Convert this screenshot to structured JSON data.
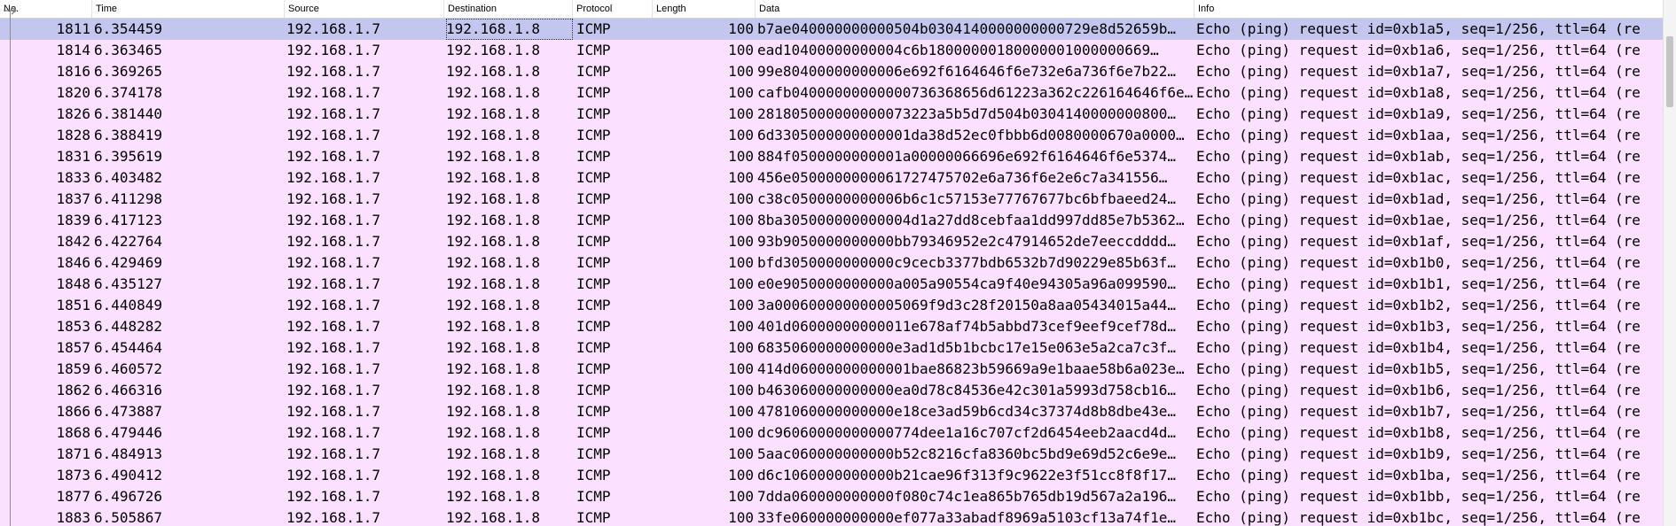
{
  "columns": [
    {
      "key": "no",
      "label": "No."
    },
    {
      "key": "time",
      "label": "Time"
    },
    {
      "key": "source",
      "label": "Source"
    },
    {
      "key": "destination",
      "label": "Destination"
    },
    {
      "key": "protocol",
      "label": "Protocol"
    },
    {
      "key": "length",
      "label": "Length"
    },
    {
      "key": "data",
      "label": "Data"
    },
    {
      "key": "info",
      "label": "Info"
    }
  ],
  "colors": {
    "row_bg": "#fce0ff",
    "selected_bg": "#c3c6ef"
  },
  "icons": {
    "selected_row_marker": "arrow-right-icon"
  },
  "packets": [
    {
      "no": "1811",
      "time": "6.354459",
      "source": "192.168.1.7",
      "destination": "192.168.1.8",
      "protocol": "ICMP",
      "length": "100",
      "data": "b7ae040000000000504b0304140000000000729e8d52659b…",
      "info": "Echo (ping) request  id=0xb1a5, seq=1/256, ttl=64 (re",
      "selected": true
    },
    {
      "no": "1814",
      "time": "6.363465",
      "source": "192.168.1.7",
      "destination": "192.168.1.8",
      "protocol": "ICMP",
      "length": "100",
      "data": "ead10400000000004c6b18000000180000001000000669…",
      "info": "Echo (ping) request  id=0xb1a6, seq=1/256, ttl=64 (re"
    },
    {
      "no": "1816",
      "time": "6.369265",
      "source": "192.168.1.7",
      "destination": "192.168.1.8",
      "protocol": "ICMP",
      "length": "100",
      "data": "99e80400000000006e692f6164646f6e732e6a736f6e7b22…",
      "info": "Echo (ping) request  id=0xb1a7, seq=1/256, ttl=64 (re"
    },
    {
      "no": "1820",
      "time": "6.374178",
      "source": "192.168.1.7",
      "destination": "192.168.1.8",
      "protocol": "ICMP",
      "length": "100",
      "data": "cafb04000000000000736368656d61223a362c226164646f6e…",
      "info": "Echo (ping) request  id=0xb1a8, seq=1/256, ttl=64 (re"
    },
    {
      "no": "1826",
      "time": "6.381440",
      "source": "192.168.1.7",
      "destination": "192.168.1.8",
      "protocol": "ICMP",
      "length": "100",
      "data": "281805000000000073223a5b5d7d504b0304140000000800…",
      "info": "Echo (ping) request  id=0xb1a9, seq=1/256, ttl=64 (re"
    },
    {
      "no": "1828",
      "time": "6.388419",
      "source": "192.168.1.7",
      "destination": "192.168.1.8",
      "protocol": "ICMP",
      "length": "100",
      "data": "6d3305000000000001da38d52ec0fbbb6d0080000670a0000…",
      "info": "Echo (ping) request  id=0xb1aa, seq=1/256, ttl=64 (re"
    },
    {
      "no": "1831",
      "time": "6.395619",
      "source": "192.168.1.7",
      "destination": "192.168.1.8",
      "protocol": "ICMP",
      "length": "100",
      "data": "884f0500000000001a00000066696e692f6164646f6e5374…",
      "info": "Echo (ping) request  id=0xb1ab, seq=1/256, ttl=64 (re"
    },
    {
      "no": "1833",
      "time": "6.403482",
      "source": "192.168.1.7",
      "destination": "192.168.1.8",
      "protocol": "ICMP",
      "length": "100",
      "data": "456e0500000000061727475702e6a736f6e2e6c7a341556…",
      "info": "Echo (ping) request  id=0xb1ac, seq=1/256, ttl=64 (re"
    },
    {
      "no": "1837",
      "time": "6.411298",
      "source": "192.168.1.7",
      "destination": "192.168.1.8",
      "protocol": "ICMP",
      "length": "100",
      "data": "c38c0500000000006b6c1c57153e77767677bc6bfbaeed24…",
      "info": "Echo (ping) request  id=0xb1ad, seq=1/256, ttl=64 (re"
    },
    {
      "no": "1839",
      "time": "6.417123",
      "source": "192.168.1.7",
      "destination": "192.168.1.8",
      "protocol": "ICMP",
      "length": "100",
      "data": "8ba305000000000004d1a27dd8cebfaa1dd997dd85e7b5362…",
      "info": "Echo (ping) request  id=0xb1ae, seq=1/256, ttl=64 (re"
    },
    {
      "no": "1842",
      "time": "6.422764",
      "source": "192.168.1.7",
      "destination": "192.168.1.8",
      "protocol": "ICMP",
      "length": "100",
      "data": "93b9050000000000bb79346952e2c47914652de7eeccdddd…",
      "info": "Echo (ping) request  id=0xb1af, seq=1/256, ttl=64 (re"
    },
    {
      "no": "1846",
      "time": "6.429469",
      "source": "192.168.1.7",
      "destination": "192.168.1.8",
      "protocol": "ICMP",
      "length": "100",
      "data": "bfd3050000000000c9cecb3377bdb6532b7d90229e85b63f…",
      "info": "Echo (ping) request  id=0xb1b0, seq=1/256, ttl=64 (re"
    },
    {
      "no": "1848",
      "time": "6.435127",
      "source": "192.168.1.7",
      "destination": "192.168.1.8",
      "protocol": "ICMP",
      "length": "100",
      "data": "e0e9050000000000a005a90554ca9f40e94305a96a099590…",
      "info": "Echo (ping) request  id=0xb1b1, seq=1/256, ttl=64 (re"
    },
    {
      "no": "1851",
      "time": "6.440849",
      "source": "192.168.1.7",
      "destination": "192.168.1.8",
      "protocol": "ICMP",
      "length": "100",
      "data": "3a000600000000005069f9d3c28f20150a8aa05434015a44…",
      "info": "Echo (ping) request  id=0xb1b2, seq=1/256, ttl=64 (re"
    },
    {
      "no": "1853",
      "time": "6.448282",
      "source": "192.168.1.7",
      "destination": "192.168.1.8",
      "protocol": "ICMP",
      "length": "100",
      "data": "401d06000000000011e678af74b5abbd73cef9eef9cef78d…",
      "info": "Echo (ping) request  id=0xb1b3, seq=1/256, ttl=64 (re"
    },
    {
      "no": "1857",
      "time": "6.454464",
      "source": "192.168.1.7",
      "destination": "192.168.1.8",
      "protocol": "ICMP",
      "length": "100",
      "data": "6835060000000000e3ad1d5b1bcbc17e15e063e5a2ca7c3f…",
      "info": "Echo (ping) request  id=0xb1b4, seq=1/256, ttl=64 (re"
    },
    {
      "no": "1859",
      "time": "6.460572",
      "source": "192.168.1.7",
      "destination": "192.168.1.8",
      "protocol": "ICMP",
      "length": "100",
      "data": "414d06000000000001bae86823b59669a9e1baae58b6a023e…",
      "info": "Echo (ping) request  id=0xb1b5, seq=1/256, ttl=64 (re"
    },
    {
      "no": "1862",
      "time": "6.466316",
      "source": "192.168.1.7",
      "destination": "192.168.1.8",
      "protocol": "ICMP",
      "length": "100",
      "data": "b463060000000000ea0d78c84536e42c301a5993d758cb16…",
      "info": "Echo (ping) request  id=0xb1b6, seq=1/256, ttl=64 (re"
    },
    {
      "no": "1866",
      "time": "6.473887",
      "source": "192.168.1.7",
      "destination": "192.168.1.8",
      "protocol": "ICMP",
      "length": "100",
      "data": "4781060000000000e18ce3ad59b6cd34c37374d8b8dbe43e…",
      "info": "Echo (ping) request  id=0xb1b7, seq=1/256, ttl=64 (re"
    },
    {
      "no": "1868",
      "time": "6.479446",
      "source": "192.168.1.7",
      "destination": "192.168.1.8",
      "protocol": "ICMP",
      "length": "100",
      "data": "dc96060000000000774dee1a16c707cf2d6454eeb2aacd4d…",
      "info": "Echo (ping) request  id=0xb1b8, seq=1/256, ttl=64 (re"
    },
    {
      "no": "1871",
      "time": "6.484913",
      "source": "192.168.1.7",
      "destination": "192.168.1.8",
      "protocol": "ICMP",
      "length": "100",
      "data": "5aac060000000000b52c8216cfa8360bc5bd9e69d52c6e9e…",
      "info": "Echo (ping) request  id=0xb1b9, seq=1/256, ttl=64 (re"
    },
    {
      "no": "1873",
      "time": "6.490412",
      "source": "192.168.1.7",
      "destination": "192.168.1.8",
      "protocol": "ICMP",
      "length": "100",
      "data": "d6c1060000000000b21cae96f313f9c9622e3f51cc8f8f17…",
      "info": "Echo (ping) request  id=0xb1ba, seq=1/256, ttl=64 (re"
    },
    {
      "no": "1877",
      "time": "6.496726",
      "source": "192.168.1.7",
      "destination": "192.168.1.8",
      "protocol": "ICMP",
      "length": "100",
      "data": "7dda060000000000f080c74c1ea865b765db19d567a2a196…",
      "info": "Echo (ping) request  id=0xb1bb, seq=1/256, ttl=64 (re"
    },
    {
      "no": "1883",
      "time": "6.505867",
      "source": "192.168.1.7",
      "destination": "192.168.1.8",
      "protocol": "ICMP",
      "length": "100",
      "data": "33fe060000000000ef077a33abadf8969a5103cf13a74f1e…",
      "info": "Echo (ping) request  id=0xb1bc, seq=1/256, ttl=64 (re"
    }
  ]
}
